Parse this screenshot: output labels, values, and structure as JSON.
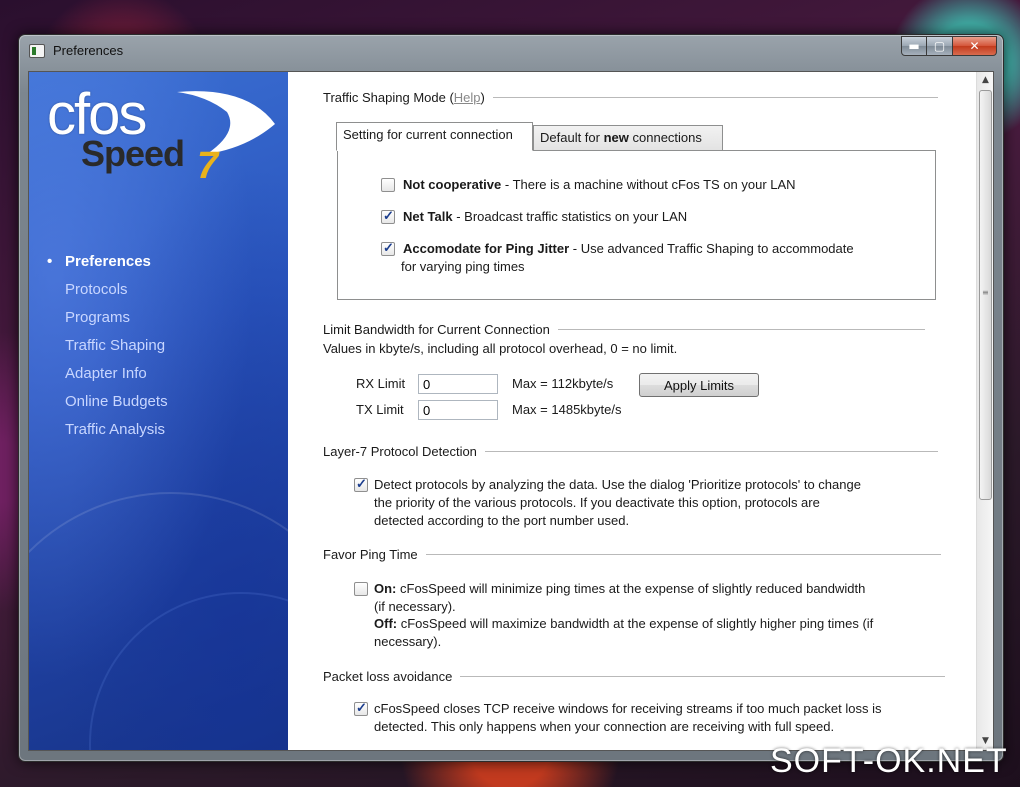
{
  "window": {
    "title": "Preferences",
    "min_glyph": "▬",
    "max_glyph": "▢",
    "close_glyph": "✕"
  },
  "logo": {
    "word1": "cfos",
    "word2": "Speed",
    "version": "7"
  },
  "sidebar": {
    "items": [
      {
        "label": "Preferences",
        "active": true
      },
      {
        "label": "Protocols"
      },
      {
        "label": "Programs"
      },
      {
        "label": "Traffic Shaping"
      },
      {
        "label": "Adapter Info"
      },
      {
        "label": "Online Budgets"
      },
      {
        "label": "Traffic Analysis"
      }
    ]
  },
  "traffic_shaping": {
    "heading": "Traffic Shaping Mode (",
    "help": "Help",
    "heading_end": ")",
    "tab_current": "Setting for current connection",
    "tab_default_pre": "Default for ",
    "tab_default_bold": "new",
    "tab_default_post": " connections",
    "options": [
      {
        "bold": "Not cooperative",
        "text": " - There is a machine without cFos TS on your LAN",
        "checked": false
      },
      {
        "bold": "Net Talk",
        "text": " - Broadcast traffic statistics on your LAN",
        "checked": true
      },
      {
        "bold": "Accomodate for Ping Jitter",
        "text": " - Use advanced Traffic Shaping to accommodate",
        "text2": "for varying ping times",
        "checked": true
      }
    ]
  },
  "bandwidth": {
    "heading": "Limit Bandwidth for Current Connection",
    "subtext": "Values in kbyte/s, including all protocol overhead, 0 = no limit.",
    "rx_label": "RX Limit",
    "rx_value": "0",
    "rx_max": "Max = 112kbyte/s",
    "tx_label": "TX Limit",
    "tx_value": "0",
    "tx_max": "Max = 1485kbyte/s",
    "apply": "Apply Limits"
  },
  "layer7": {
    "heading": "Layer-7 Protocol Detection",
    "checked": true,
    "lines": [
      "Detect protocols by analyzing the data. Use the dialog 'Prioritize protocols' to change",
      "the priority of the various protocols. If you deactivate this option, protocols are",
      "detected according to the port number used."
    ]
  },
  "ping": {
    "heading": "Favor Ping Time",
    "checked": false,
    "on_bold": "On:",
    "on_text": " cFosSpeed will minimize ping times at the expense of slightly reduced bandwidth",
    "on_text2": "(if necessary).",
    "off_bold": "Off:",
    "off_text": " cFosSpeed will maximize bandwidth at the expense of slightly higher ping times (if",
    "off_text2": "necessary)."
  },
  "packetloss": {
    "heading": "Packet loss avoidance",
    "checked": true,
    "lines": [
      "cFosSpeed closes TCP receive windows for receiving streams if too much packet loss is",
      "detected. This only happens when your connection are receiving with full speed."
    ]
  },
  "scrollbar": {
    "up": "▲",
    "down": "▼",
    "grip": "≡"
  },
  "watermark": "SOFT-OK.NET"
}
